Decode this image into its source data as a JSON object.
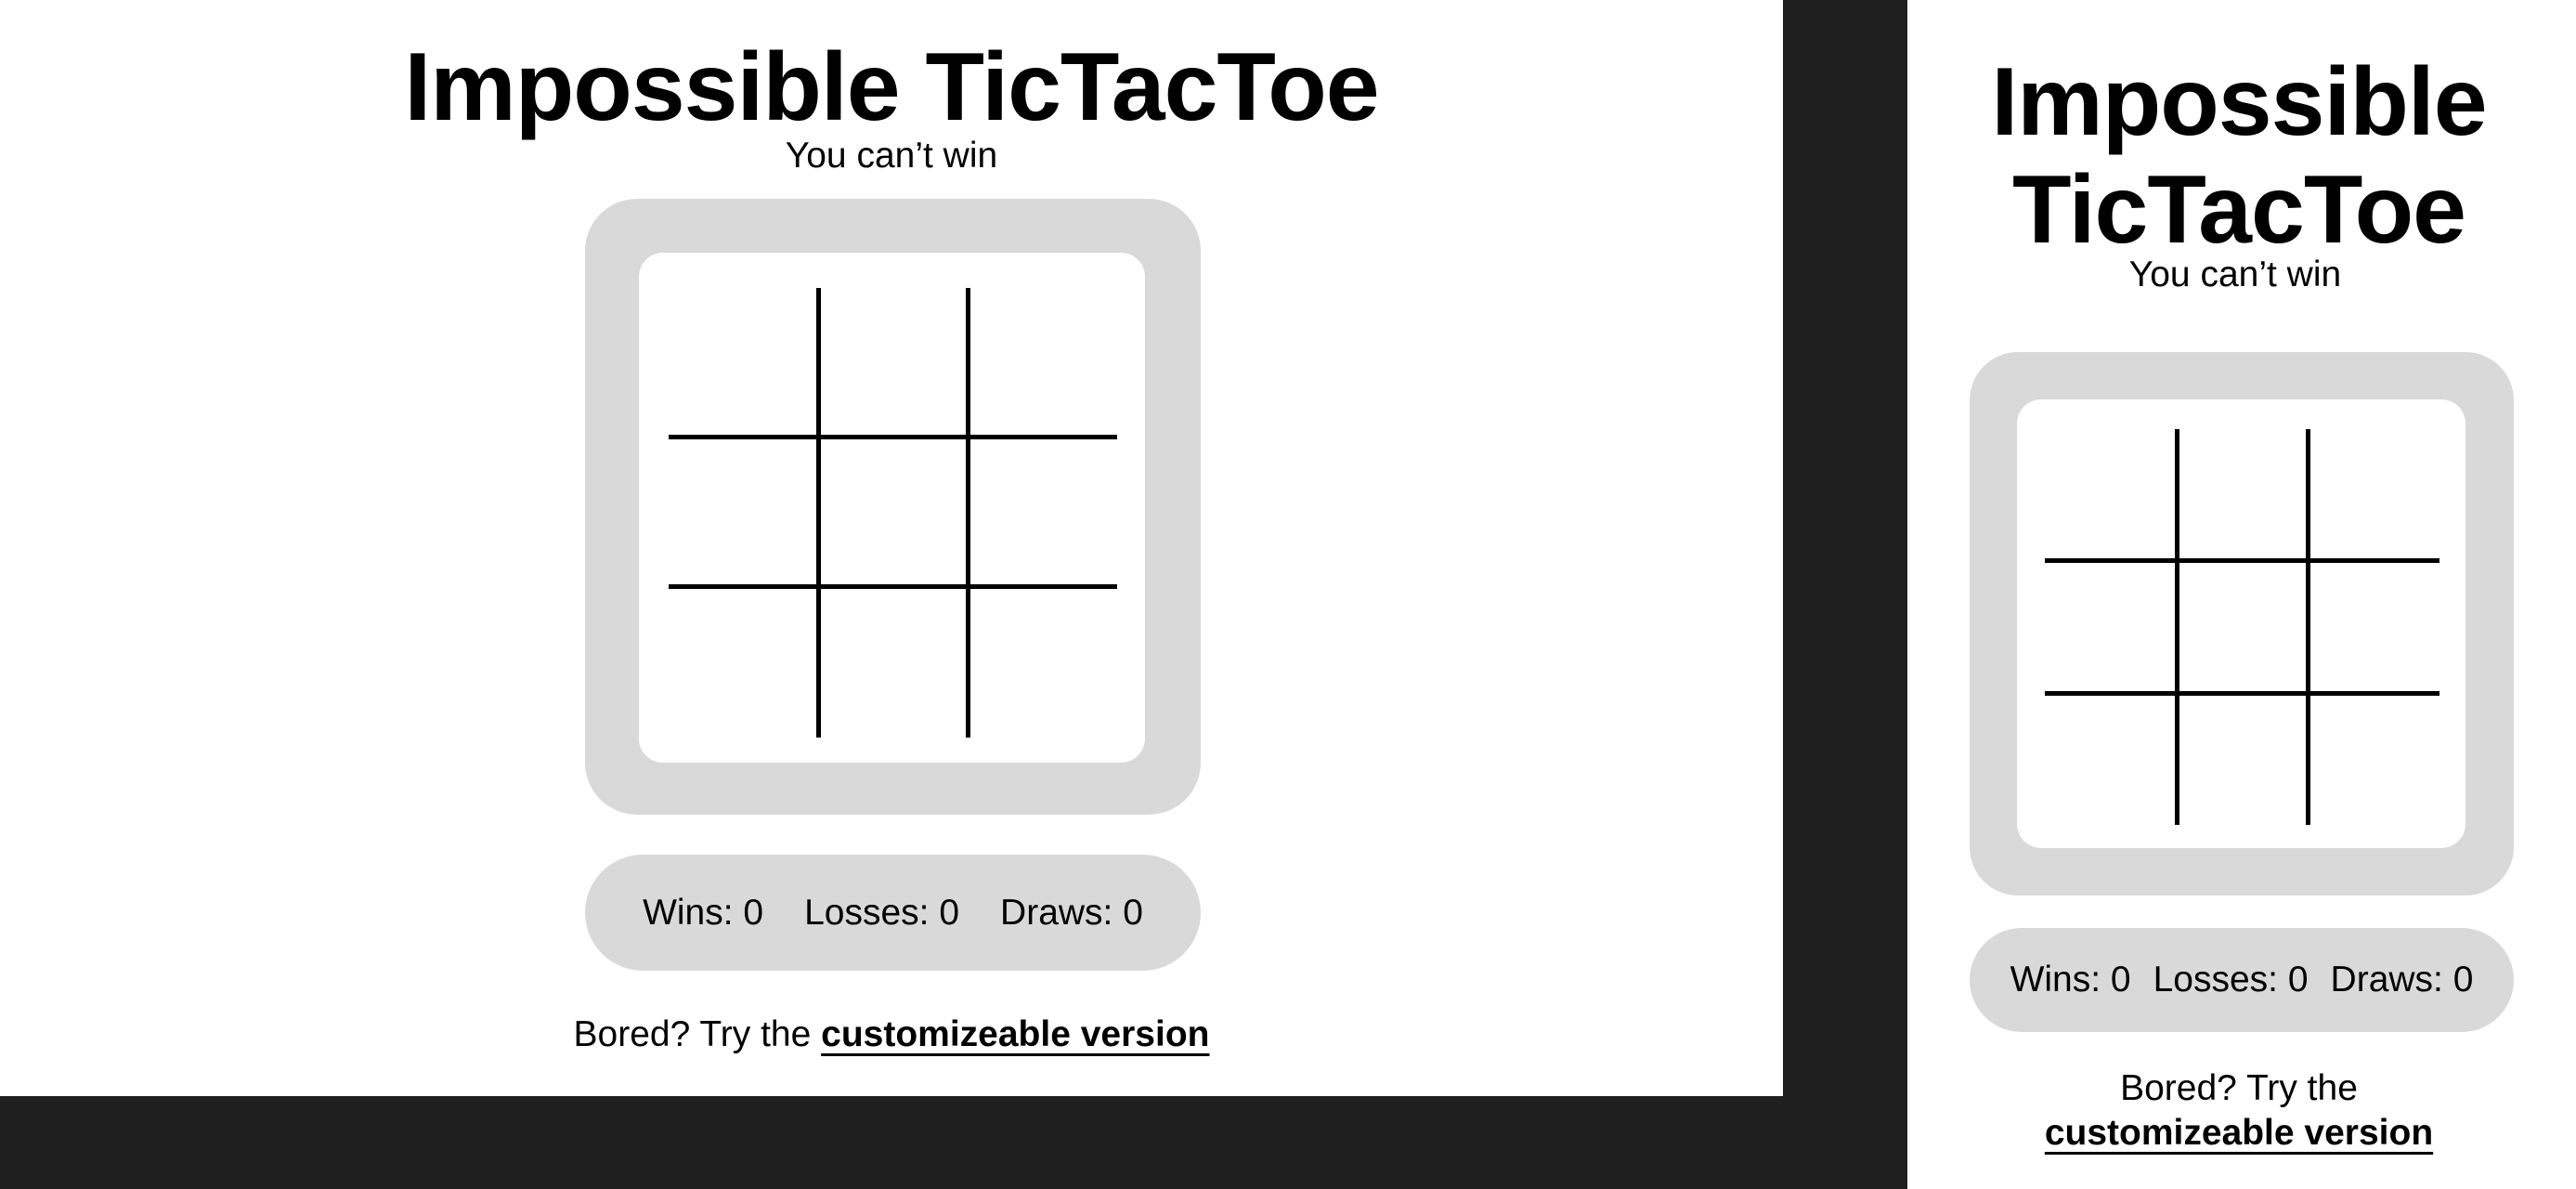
{
  "title": "Impossible TicTacToe",
  "title_line1": "Impossible",
  "title_line2": "TicTacToe",
  "subtitle": "You can’t win",
  "stats": {
    "wins": "Wins: 0",
    "losses": "Losses: 0",
    "draws": "Draws: 0"
  },
  "footer": {
    "prefix": "Bored? Try the",
    "link": "customizeable version"
  },
  "colors": {
    "board": "#d9d9d9",
    "background": "#1f1f1f"
  }
}
